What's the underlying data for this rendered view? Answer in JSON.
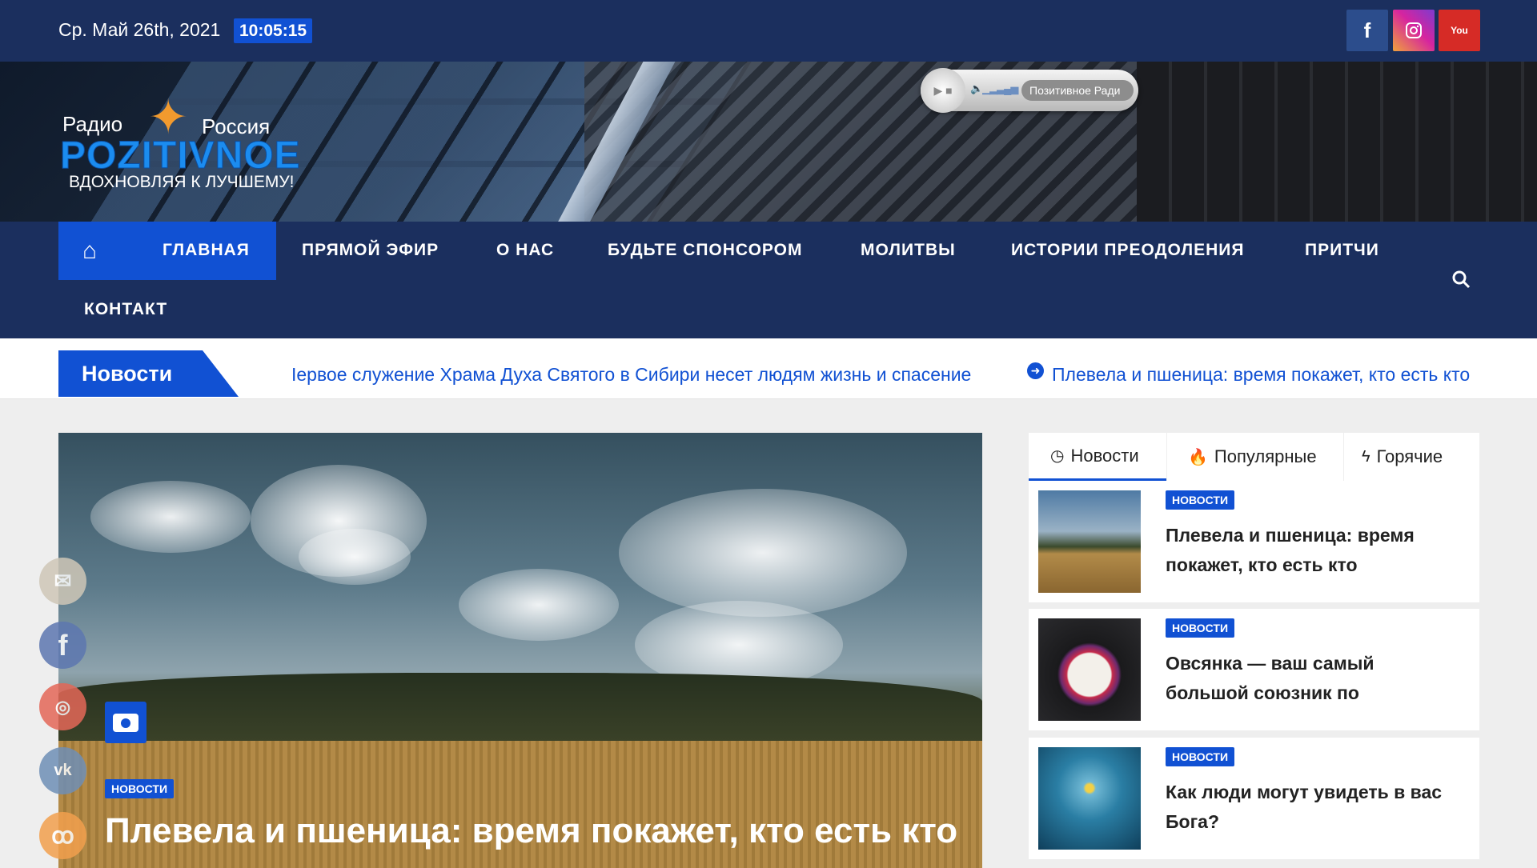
{
  "topbar": {
    "date": "Ср. Май 26th, 2021",
    "time": "10:05:15",
    "social": [
      "facebook-icon",
      "instagram-icon",
      "youtube-icon"
    ],
    "youtube_label": "You"
  },
  "logo": {
    "radio": "Радио",
    "russia": "Россия",
    "brand": "POZITIVNOE",
    "slogan": "ВДОХНОВЛЯЯ К ЛУЧШЕМУ!"
  },
  "player": {
    "station": "Позитивное Ради"
  },
  "nav": {
    "items": [
      "ГЛАВНАЯ",
      "ПРЯМОЙ ЭФИР",
      "О НАС",
      "БУДЬТЕ СПОНСОРОМ",
      "МОЛИТВЫ",
      "ИСТОРИИ ПРЕОДОЛЕНИЯ",
      "ПРИТЧИ",
      "КОНТАКТ"
    ]
  },
  "ticker": {
    "label": "Новости",
    "items": [
      "Іервое служение Храма Духа Святого в Сибири несет людям жизнь и спасение",
      "Плевела и пшеница: время покажет, кто есть кто"
    ]
  },
  "hero": {
    "category": "НОВОСТИ",
    "title": "Плевела и пшеница: время покажет, кто есть кто"
  },
  "sidebar": {
    "tabs": [
      "Новости",
      "Популярные",
      "Горячие"
    ],
    "posts": [
      {
        "category": "НОВОСТИ",
        "title": "Плевела и пшеница: время покажет, кто есть кто"
      },
      {
        "category": "НОВОСТИ",
        "title": "Овсянка — ваш самый большой союзник по"
      },
      {
        "category": "НОВОСТИ",
        "title": "Как люди могут увидеть в вас Бога?"
      }
    ]
  },
  "colors": {
    "navy": "#1b2f5e",
    "accent": "#1151d3"
  }
}
